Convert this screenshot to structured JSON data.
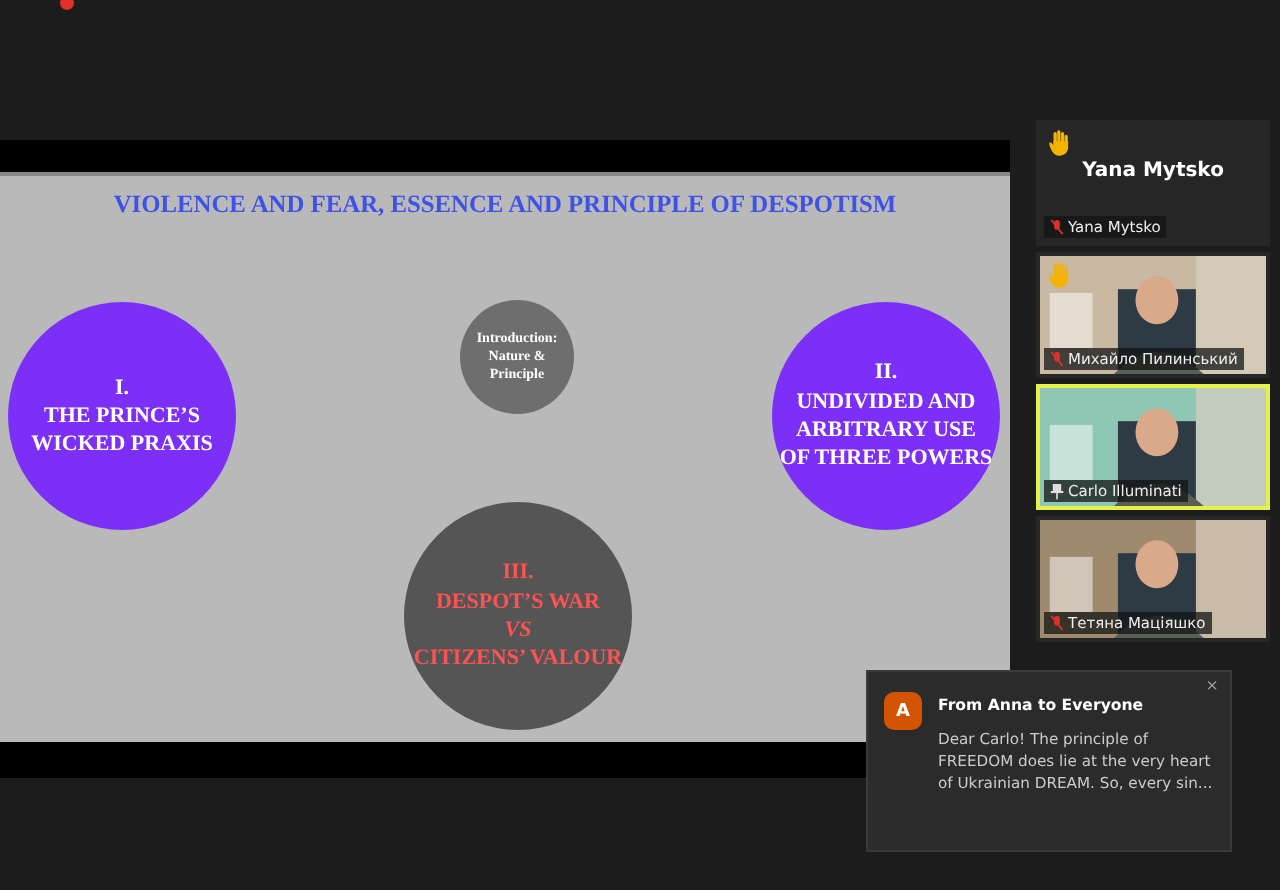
{
  "slide": {
    "title": "VIOLENCE AND FEAR, ESSENCE AND PRINCIPLE OF DESPOTISM",
    "circles": [
      {
        "kind": "section",
        "color": "#7b2ff7",
        "lines": [
          "I.",
          "THE PRINCE’S",
          "WICKED PRAXIS"
        ]
      },
      {
        "kind": "intro",
        "color": "#6e6e6e",
        "lines": [
          "Introduction:",
          "Nature &",
          "Principle"
        ]
      },
      {
        "kind": "section",
        "color": "#7b2ff7",
        "lines": [
          "II.",
          "UNDIVIDED AND",
          "ARBITRARY USE",
          "OF THREE POWERS"
        ]
      },
      {
        "kind": "conflict",
        "color": "#555555",
        "lines": [
          "III.",
          "DESPOT’S WAR",
          "*VS*",
          "CITIZENS’ VALOUR"
        ]
      }
    ]
  },
  "participants": [
    {
      "kind": "name",
      "display_name": "Yana Mytsko",
      "name": "Yana Mytsko",
      "muted": true,
      "hand_raised": true,
      "pinned": false,
      "speaking": false
    },
    {
      "kind": "video",
      "name": "Михайло Пилинський",
      "muted": true,
      "hand_raised": true,
      "pinned": false,
      "speaking": false
    },
    {
      "kind": "video",
      "name": "Carlo Illuminati",
      "muted": false,
      "hand_raised": false,
      "pinned": true,
      "speaking": true
    },
    {
      "kind": "video",
      "name": "Тетяна Маціяшко",
      "muted": true,
      "hand_raised": false,
      "pinned": false,
      "speaking": false
    }
  ],
  "chat_notification": {
    "avatar_letter": "A",
    "title": "From Anna to Everyone",
    "message": "Dear Carlo! The principle of FREEDOM does lie at the very heart of Ukrainian DREAM. So, every sin...",
    "close": "×"
  }
}
